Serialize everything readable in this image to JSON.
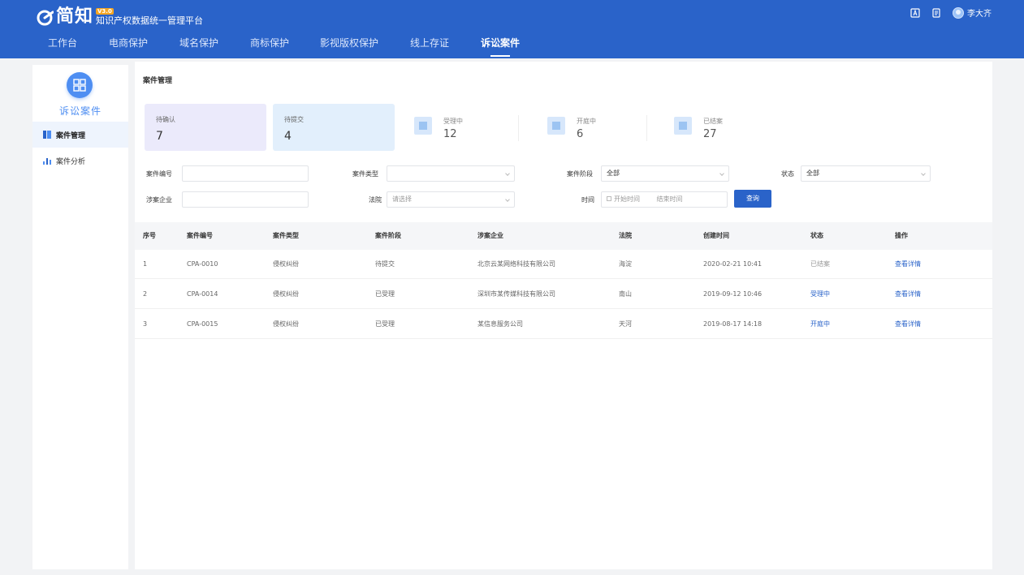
{
  "header": {
    "logo_text": "简知",
    "logo_badge": "V3.0",
    "platform_name": "知识产权数据统一管理平台",
    "nav": [
      {
        "label": "工作台"
      },
      {
        "label": "电商保护"
      },
      {
        "label": "域名保护"
      },
      {
        "label": "商标保护"
      },
      {
        "label": "影视版权保护"
      },
      {
        "label": "线上存证"
      },
      {
        "label": "诉讼案件"
      }
    ],
    "active_nav": "诉讼案件",
    "username": "李大齐",
    "accent_color": "#2a63c9"
  },
  "sidebar": {
    "title": "诉讼案件",
    "items": [
      {
        "label": "案件管理",
        "icon": "case-management-icon",
        "active": true
      },
      {
        "label": "案件分析",
        "icon": "bar-chart-icon",
        "active": false
      }
    ]
  },
  "main": {
    "title": "案件管理",
    "cards": [
      {
        "label": "待确认",
        "value": "7"
      },
      {
        "label": "待提交",
        "value": "4"
      }
    ],
    "stats": [
      {
        "label": "受理中",
        "value": "12"
      },
      {
        "label": "开庭中",
        "value": "6"
      },
      {
        "label": "已结案",
        "value": "27"
      }
    ],
    "filters": {
      "case_no_label": "案件编号",
      "case_type_label": "案件类型",
      "case_status_label": "案件阶段",
      "case_status_value": "全部",
      "owner_label": "状态",
      "owner_value": "全部",
      "company_label": "涉案企业",
      "court_label": "法院",
      "court_placeholder": "请选择",
      "date_label": "时间",
      "date_start": "开始时间",
      "date_end": "结束时间",
      "search_button": "查询"
    },
    "table": {
      "columns": [
        "序号",
        "案件编号",
        "案件类型",
        "案件阶段",
        "涉案企业",
        "法院",
        "创建时间",
        "状态",
        "操作"
      ],
      "rows": [
        {
          "no": "1",
          "case_no": "CPA-0010",
          "type": "侵权纠纷",
          "stage": "待提交",
          "company": "北京云某网络科技有限公司",
          "court": "海淀",
          "time": "2020-02-21 10:41",
          "status": "已结案",
          "action": "查看详情"
        },
        {
          "no": "2",
          "case_no": "CPA-0014",
          "type": "侵权纠纷",
          "stage": "已受理",
          "company": "深圳市某传媒科技有限公司",
          "court": "南山",
          "time": "2019-09-12 10:46",
          "status": "受理中",
          "action": "查看详情"
        },
        {
          "no": "3",
          "case_no": "CPA-0015",
          "type": "侵权纠纷",
          "stage": "已受理",
          "company": "某信息服务公司",
          "court": "天河",
          "time": "2019-08-17 14:18",
          "status": "开庭中",
          "action": "查看详情"
        }
      ]
    }
  }
}
